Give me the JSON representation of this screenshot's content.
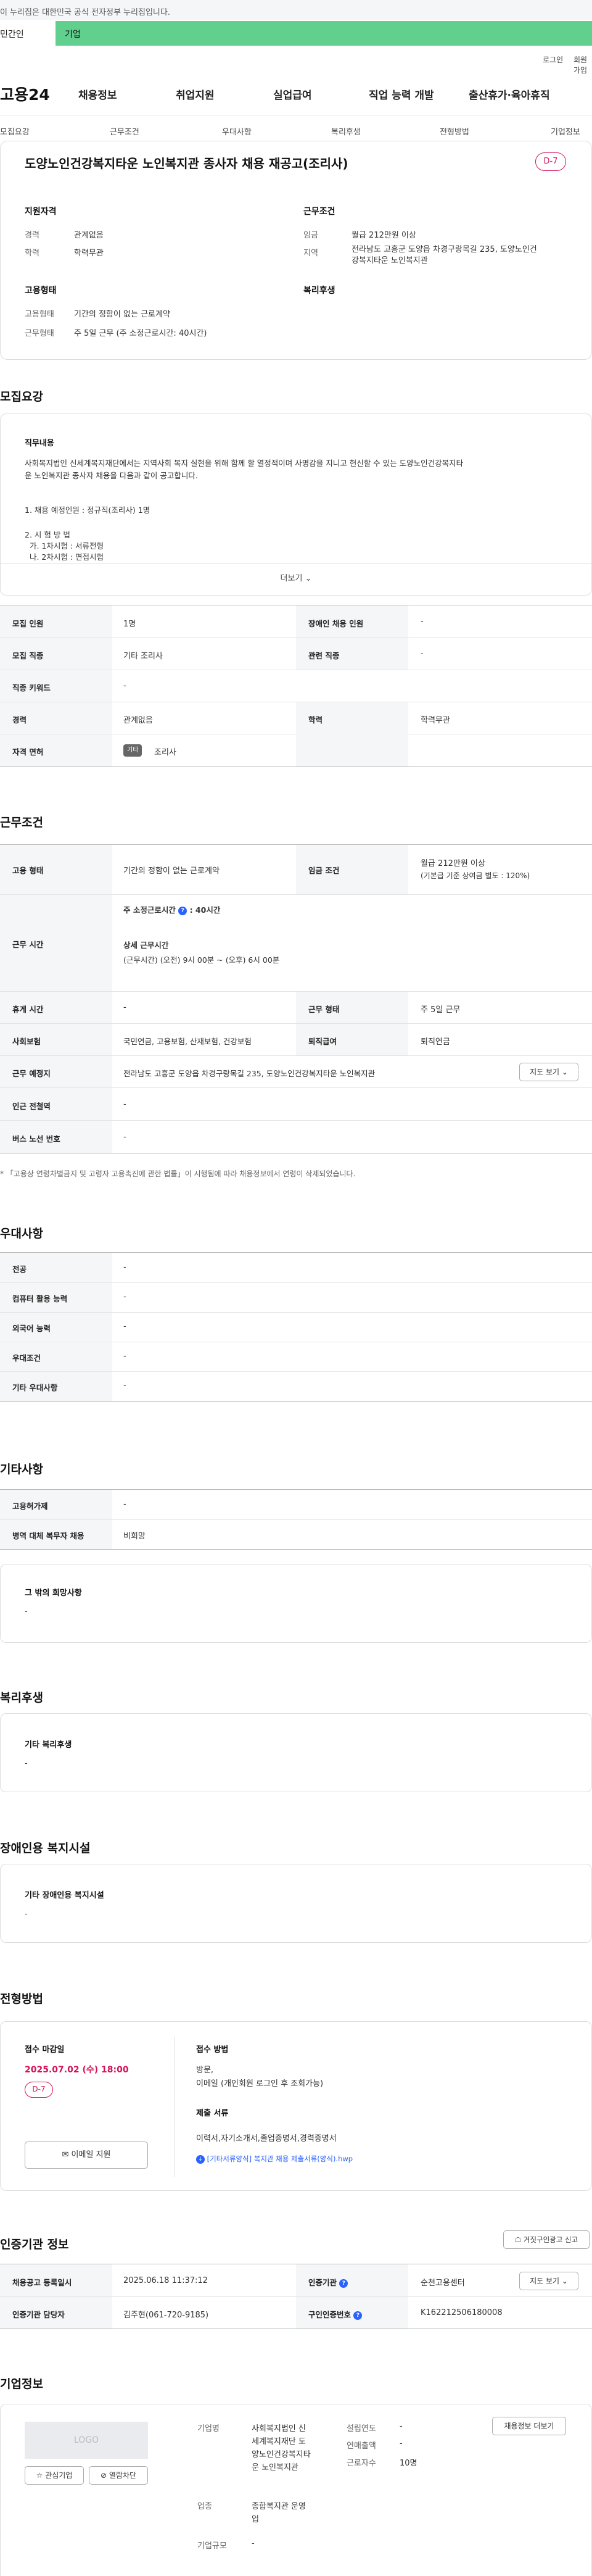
{
  "gov_banner": {
    "text": "이 누리집은 대한민국 공식 전자정부 누리집입니다.",
    "left_text": "민간인",
    "right_text": "기업"
  },
  "util_links": {
    "login": "로그인",
    "join": "회원가입"
  },
  "site": {
    "logo": "고용24"
  },
  "gnb": [
    "채용정보",
    "취업지원",
    "실업급여",
    "직업 능력 개발",
    "출산휴가·육아휴직"
  ],
  "tabs": [
    "모집요강",
    "근무조건",
    "우대사항",
    "복리후생",
    "전형방법",
    "기업정보"
  ],
  "job": {
    "title": "도양노인건강복지타운 노인복지관 종사자 채용 재공고(조리사)",
    "dday": "D-7"
  },
  "summary": {
    "qual_h": "지원자격",
    "career_l": "경력",
    "career_v": "관계없음",
    "edu_l": "학력",
    "edu_v": "학력무관",
    "work_h": "근무조건",
    "wage_l": "임금",
    "wage_v": "월급 212만원 이상",
    "region_l": "지역",
    "region_v1": "전라남도 고흥군 도양읍 차경구랑목길 235, 도양노인건",
    "region_v2": "강복지타운 노인복지관",
    "emp_h": "고용형태",
    "emptype_l": "고용형태",
    "emptype_v": "기간의 정함이 없는 근로계약",
    "worktype_l": "근무형태",
    "worktype_v": "주 5일 근무 (주 소정근로시간: 40시간)",
    "welfare_h": "복리후생"
  },
  "recruit": {
    "heading": "모집요강",
    "duty_h": "직무내용",
    "duty_lines": [
      "사회복지법인 신세계복지재단에서는 지역사회 복지 실현을 위해 함께 할 열정적이며 사명감을 지니고 헌신할 수 있는 도양노인건강복지타",
      "운 노인복지관 종사자 채용을 다음과 같이 공고합니다.",
      "",
      "1. 채용 예정인원 : 정규직(조리사) 1명",
      "",
      "2. 시 험 방 법",
      "  가. 1차시험 : 서류전형",
      "  나. 2차시험 : 면접시험"
    ],
    "more": "더보기"
  },
  "recruit_table": {
    "headcount_l": "모집 인원",
    "headcount_v": "1명",
    "disabled_l": "장애인 채용 인원",
    "disabled_v": "-",
    "job_l": "모집 직종",
    "job_v": "기타 조리사",
    "related_l": "관련 직종",
    "related_v": "-",
    "keyword_l": "직종 키워드",
    "keyword_v": "-",
    "career_l": "경력",
    "career_v": "관계없음",
    "edu_l": "학력",
    "edu_v": "학력무관",
    "license_l": "자격 면허",
    "license_chip": "기타",
    "license_v": "조리사"
  },
  "conditions": {
    "heading": "근무조건",
    "emptype_l": "고용 형태",
    "emptype_v": "기간의 정함이 없는 근로계약",
    "wage_l": "임금 조건",
    "wage_v1": "월급 212만원 이상",
    "wage_v2": "(기본급 기준 상여금 별도 : 120%)",
    "hours_l": "근무 시간",
    "hours_main": "주 소정근로시간",
    "hours_main_v": ": 40시간",
    "hours_detail_h": "상세 근무시간",
    "hours_detail_v": "(근무시간) (오전) 9시 00분 ~ (오후) 6시 00분",
    "rest_l": "휴게 시간",
    "rest_v": "-",
    "worktype_l": "근무 형태",
    "worktype_v": "주 5일 근무",
    "insurance_l": "사회보험",
    "insurance_v": "국민연금, 고용보험, 산재보험, 건강보험",
    "retire_l": "퇴직급여",
    "retire_v": "퇴직연금",
    "place_l": "근무 예정지",
    "place_v": "전라남도 고흥군 도양읍 차경구랑목길 235, 도양노인건강복지타운 노인복지관",
    "map_btn": "지도 보기",
    "subway_l": "인근 전철역",
    "subway_v": "-",
    "bus_l": "버스 노선 번호",
    "bus_v": "-",
    "note": "* 「고용상 연령차별금지 및 고령자 고용촉진에 관한 법률」이 시행됨에 따라 채용정보에서 연령이 삭제되었습니다."
  },
  "preference": {
    "heading": "우대사항",
    "major_l": "전공",
    "major_v": "-",
    "pc_l": "컴퓨터 활용 능력",
    "pc_v": "-",
    "lang_l": "외국어 능력",
    "lang_v": "-",
    "cond_l": "우대조건",
    "cond_v": "-",
    "etc_l": "기타 우대사항",
    "etc_v": "-"
  },
  "etc": {
    "heading": "기타사항",
    "permit_l": "고용허가제",
    "permit_v": "-",
    "military_l": "병역 대체 복무자 채용",
    "military_v": "비희망",
    "other_h": "그 밖의 희망사항",
    "other_v": "-"
  },
  "welfare": {
    "heading": "복리후생",
    "box_h": "기타 복리후생",
    "box_v": "-"
  },
  "disabled_fac": {
    "heading": "장애인용 복지시설",
    "box_h": "기타 장애인용 복지시설",
    "box_v": "-"
  },
  "selection": {
    "heading": "전형방법",
    "deadline_h": "접수 마감일",
    "deadline_v": "2025.07.02 (수) 18:00",
    "dday": "D-7",
    "email_btn": "이메일 지원",
    "method_h": "접수 방법",
    "method_v1": "방문,",
    "method_v2": "이메일 (개인회원 로그인 후 조회가능)",
    "docs_h": "제출 서류",
    "docs_v": "이력서,자기소개서,졸업증명서,경력증명서",
    "file": "[기타서류양식] 복지관 채용 제출서류(양식).hwp"
  },
  "cert": {
    "heading": "인증기관 정보",
    "report_btn": "거짓구인광고 신고",
    "reg_l": "채용공고 등록일시",
    "reg_v": "2025.06.18 11:37:12",
    "agency_l": "인증기관",
    "agency_v": "순천고용센터",
    "map_btn": "지도 보기",
    "manager_l": "인증기관 담당자",
    "manager_v": "김주현(061-720-9185)",
    "cert_no_l": "구인인증번호",
    "cert_no_v": "K162212506180008"
  },
  "company": {
    "heading": "기업정보",
    "logo_ph": "LOGO",
    "fav_btn": "관심기업",
    "block_btn": "열람차단",
    "name_l": "기업명",
    "name_v": [
      "사회복지법인 신",
      "세계복지재단 도",
      "양노인건강복지타",
      "운 노인복지관"
    ],
    "found_l": "설립연도",
    "found_v": "-",
    "sales_l": "연매출액",
    "sales_v": "-",
    "emp_l": "근로자수",
    "emp_v": "10명",
    "more_btn": "채용정보 더보기",
    "industry_l": "업종",
    "industry_v": [
      "종합복지관 운영",
      "업"
    ],
    "size_l": "기업규모",
    "size_v": "-"
  },
  "colors": {
    "accent_green": "#61d08f",
    "dday_red": "#d4145a",
    "deadline_red": "#d4145a",
    "link_blue": "#2962ff"
  }
}
